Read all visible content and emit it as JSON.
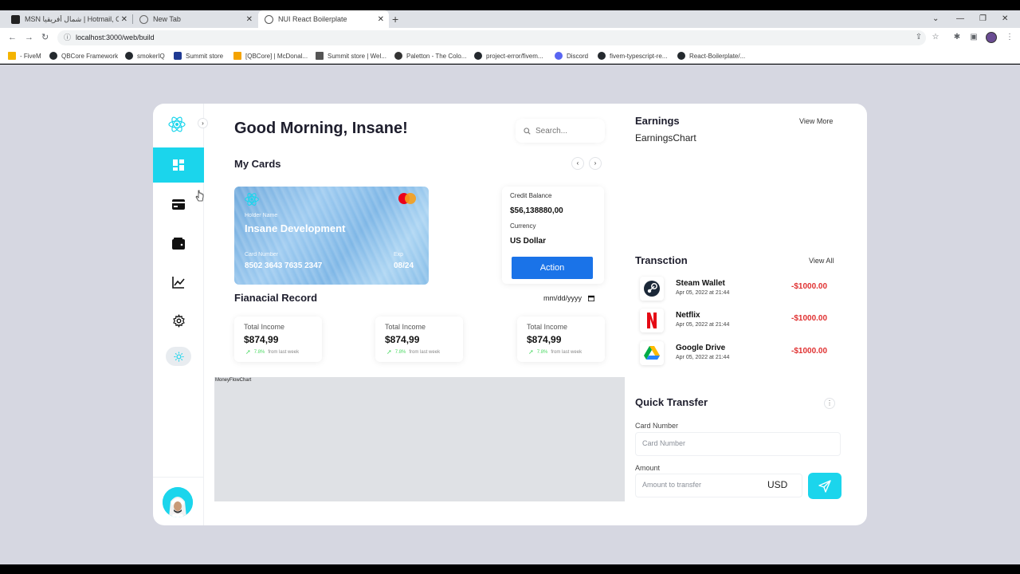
{
  "browser": {
    "tabs": [
      {
        "title": "MSN شمال أفريقيا | Hotmail, Outl"
      },
      {
        "title": "New Tab"
      },
      {
        "title": "NUI React Boilerplate"
      }
    ],
    "new_tab_symbol": "+",
    "url": "localhost:3000/web/build",
    "bookmarks": [
      {
        "label": "- FiveM",
        "color": "#f4b400"
      },
      {
        "label": "QBCore Framework",
        "color": "#24292e"
      },
      {
        "label": "smokerIQ",
        "color": "#24292e"
      },
      {
        "label": "Summit store",
        "color": "#1f3a93"
      },
      {
        "label": "[QBCore] | McDonal...",
        "color": "#f4a300"
      },
      {
        "label": "Summit store | Wel...",
        "color": "#555555"
      },
      {
        "label": "Paletton - The Colo...",
        "color": "#333333"
      },
      {
        "label": "project-error/fivem...",
        "color": "#24292e"
      },
      {
        "label": "Discord",
        "color": "#5865f2"
      },
      {
        "label": "fivem-typescript-re...",
        "color": "#24292e"
      },
      {
        "label": "React-Boilerplate/...",
        "color": "#24292e"
      }
    ]
  },
  "app": {
    "greeting": "Good Morning, Insane!",
    "search_placeholder": "Search...",
    "my_cards_title": "My Cards",
    "card": {
      "holder_label": "Holder Name",
      "holder_name": "Insane Development",
      "number_label": "Card Number",
      "number": "8502 3643 7635 2347",
      "exp_label": "Exp",
      "exp": "08/24"
    },
    "balance": {
      "credit_label": "Credit Balance",
      "credit_value": "$56,138880,00",
      "currency_label": "Currency",
      "currency_value": "US Dollar",
      "action_label": "Action"
    },
    "financial_title": "Fianacial Record",
    "date_placeholder": "mm/dd/yyyy",
    "income_cards": [
      {
        "title": "Total Income",
        "value": "$874,99",
        "pct": "7.8%",
        "note": "from last week"
      },
      {
        "title": "Total Income",
        "value": "$874,99",
        "pct": "7.8%",
        "note": "from last week"
      },
      {
        "title": "Total Income",
        "value": "$874,99",
        "pct": "7.8%",
        "note": "from last week"
      }
    ],
    "moneyflow_label": "MoneyFlowChart",
    "earnings_title": "Earnings",
    "earnings_view_more": "View More",
    "earnings_chart_label": "EarningsChart",
    "transactions_title": "Transction",
    "transactions_view_all": "View All",
    "transactions": [
      {
        "name": "Steam Wallet",
        "date": "Apr 05, 2022 at 21:44",
        "amount": "-$1000.00",
        "icon": "steam-icon"
      },
      {
        "name": "Netflix",
        "date": "Apr 05, 2022 at 21:44",
        "amount": "-$1000.00",
        "icon": "netflix-icon"
      },
      {
        "name": "Google Drive",
        "date": "Apr 05, 2022 at 21:44",
        "amount": "-$1000.00",
        "icon": "google-drive-icon"
      }
    ],
    "quick_transfer_title": "Quick Transfer",
    "card_number_label": "Card Number",
    "card_number_placeholder": "Card Number",
    "amount_label": "Amount",
    "amount_placeholder": "Amount to transfer",
    "currency_code": "USD",
    "accent_color": "#1bd5ec",
    "action_color": "#1a73e8",
    "negative_color": "#e03131"
  }
}
